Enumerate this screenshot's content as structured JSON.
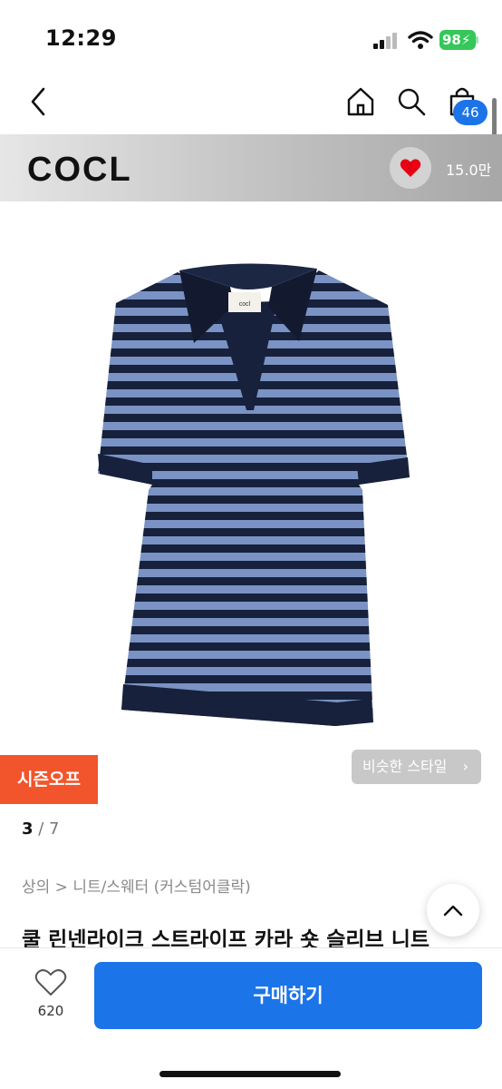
{
  "status_bar": {
    "time": "12:29",
    "battery": "98"
  },
  "nav": {
    "cart_count": "46"
  },
  "brand": {
    "logo_text": "COCL",
    "likes": "15.0만"
  },
  "product": {
    "season_badge": "시즌오프",
    "similar_style": "비슷한 스타일",
    "image_index": "3",
    "image_total": "7",
    "category": "상의 > 니트/스웨터 (커스텀어클락)",
    "title": "쿨 린넨라이크 스트라이프 카라 숏 슬리브 니트"
  },
  "bottom": {
    "wish_count": "620",
    "buy_label": "구매하기"
  },
  "colors": {
    "accent": "#1b74e8",
    "badge": "#f2552c",
    "stripe_dark": "#17213b",
    "stripe_light": "#7a93c4"
  }
}
